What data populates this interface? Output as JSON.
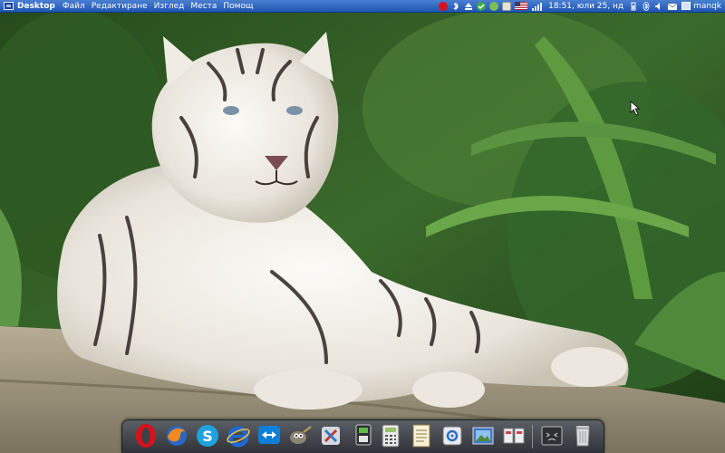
{
  "top_panel": {
    "app_title": "Desktop",
    "menus": [
      "Файл",
      "Редактиране",
      "Изглед",
      "Места",
      "Помощ"
    ],
    "tray_icons": [
      "opera-tray-icon",
      "bluetooth-tray-icon",
      "eject-icon",
      "update-checkmark-icon",
      "shield-icon",
      "clipboard-icon",
      "us-flag-keyboard-icon",
      "network-signal-icon"
    ],
    "clock": "18:51, юли 25, нд",
    "status_icons": [
      "battery-icon",
      "bluetooth-icon",
      "volume-icon",
      "mail-icon"
    ],
    "username": "manqk"
  },
  "dock": {
    "items": [
      "opera-icon",
      "firefox-icon",
      "skype-icon",
      "internet-explorer-icon",
      "teamviewer-icon",
      "gimp-icon",
      "paint-tools-icon",
      "terminal-icon",
      "calculator-icon",
      "notes-icon",
      "settings-icon",
      "image-viewer-icon",
      "photos-icon",
      "system-monitor-icon",
      "trash-icon"
    ]
  },
  "colors": {
    "panel_top": "#4a7fd0",
    "panel_bottom": "#1f56b4",
    "dock": "#3d4046"
  }
}
